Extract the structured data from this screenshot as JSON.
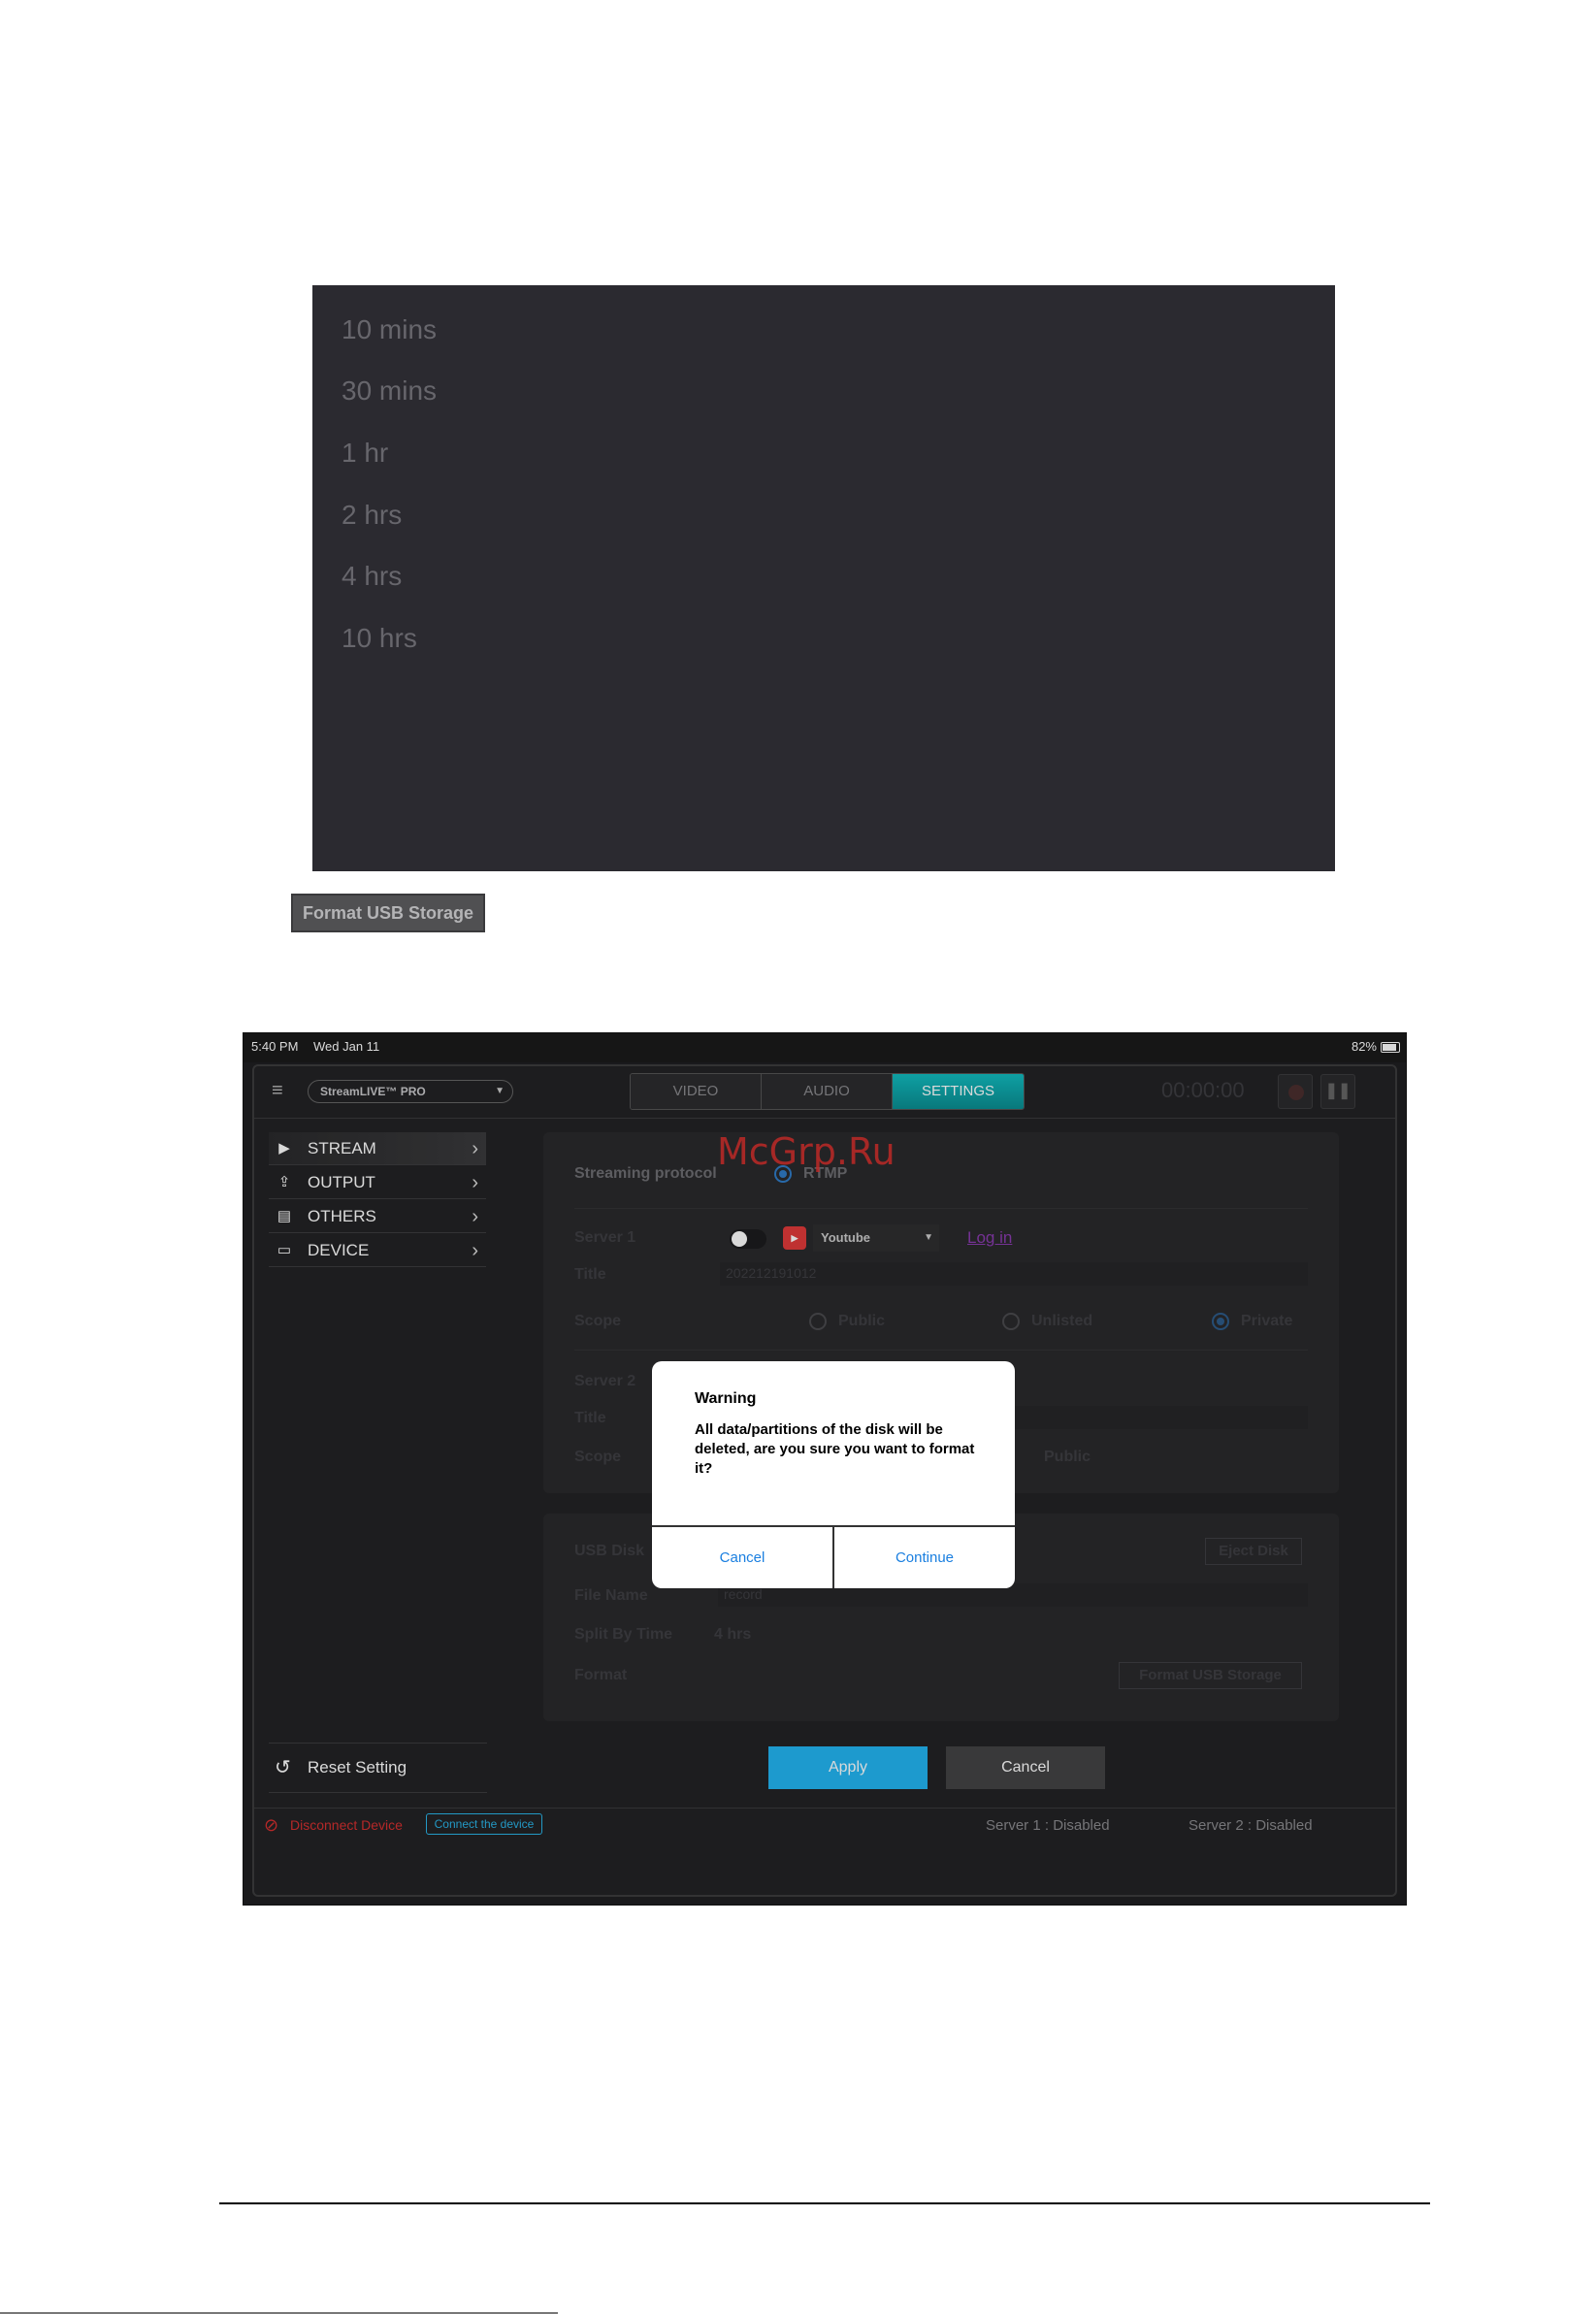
{
  "time_options": [
    "10 mins",
    "30 mins",
    "1 hr",
    "2 hrs",
    "4 hrs",
    "10 hrs"
  ],
  "format_button_label": "Format USB Storage",
  "status_bar": {
    "time": "5:40 PM",
    "date": "Wed Jan 11",
    "battery": "82%"
  },
  "header": {
    "menu_icon": "hamburger-icon",
    "device_name": "StreamLIVE™ PRO",
    "tabs": [
      {
        "label": "VIDEO",
        "active": false
      },
      {
        "label": "AUDIO",
        "active": false
      },
      {
        "label": "SETTINGS",
        "active": true
      }
    ],
    "timer": "00:00:00",
    "accent_color": "#12bcc0"
  },
  "sidebar": {
    "items": [
      {
        "label": "STREAM",
        "icon": "play-icon"
      },
      {
        "label": "OUTPUT",
        "icon": "upload-icon"
      },
      {
        "label": "OTHERS",
        "icon": "document-icon"
      },
      {
        "label": "DEVICE",
        "icon": "device-icon"
      }
    ],
    "reset_label": "Reset Setting"
  },
  "stream_panel": {
    "protocol_label": "Streaming protocol",
    "protocol_value": "RTMP",
    "server1_label": "Server 1",
    "platform": "Youtube",
    "login_label": "Log in",
    "title_label": "Title",
    "title_value": "202212191012",
    "scope_label": "Scope",
    "scope_options": [
      "Public",
      "Unlisted",
      "Private"
    ],
    "scope_selected": "Private",
    "server2_label": "Server 2",
    "server2_title_label": "Title",
    "server2_scope_label": "Scope",
    "server2_scope_value": "Public"
  },
  "usb_panel": {
    "usb_disk_label": "USB Disk",
    "eject_label": "Eject Disk",
    "file_name_label": "File Name",
    "file_name_value": "record",
    "split_label": "Split By Time",
    "split_value": "4 hrs",
    "format_label": "Format",
    "format_button": "Format USB Storage"
  },
  "actions": {
    "apply": "Apply",
    "cancel": "Cancel",
    "apply_color": "#23b6f3"
  },
  "bottom_bar": {
    "disconnect_label": "Disconnect Device",
    "connect_label": "Connect the device",
    "server1_status": "Server 1 :   Disabled",
    "server2_status": "Server 2 :   Disabled",
    "disconnect_color": "#d63030"
  },
  "dialog": {
    "title": "Warning",
    "message": "All data/partitions of the disk will be deleted, are you sure you want to format it?",
    "cancel": "Cancel",
    "continue": "Continue"
  },
  "watermark": "McGrp.Ru"
}
